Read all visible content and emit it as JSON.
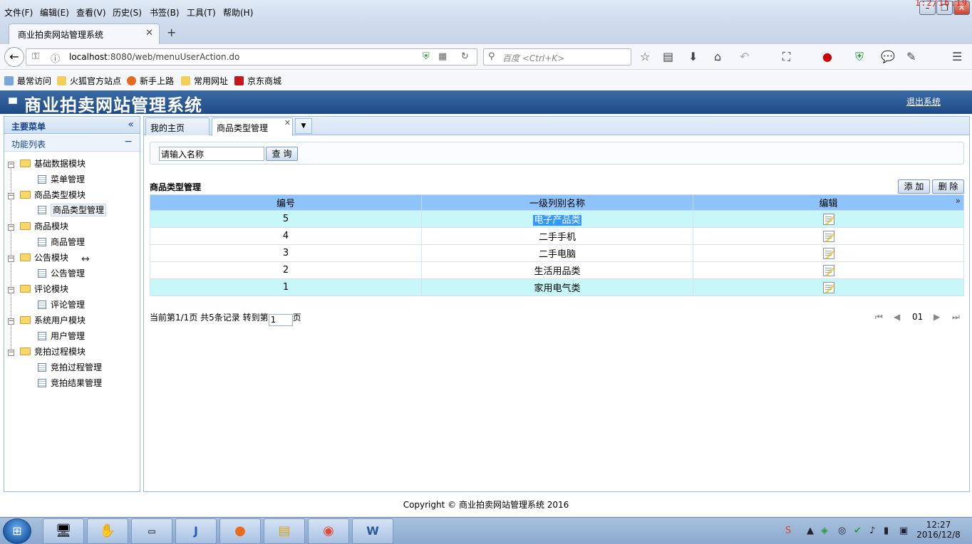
{
  "browser": {
    "menu": [
      "文件(F)",
      "编辑(E)",
      "查看(V)",
      "历史(S)",
      "书签(B)",
      "工具(T)",
      "帮助(H)"
    ],
    "overlay_time": "1:2/16:19",
    "tab_title": "商业拍卖网站管理系统",
    "url_host": "localhost",
    "url_rest": ":8080/web/menuUserAction.do",
    "search_placeholder": "百度 <Ctrl+K>",
    "bookmarks": [
      "最常访问",
      "火狐官方站点",
      "新手上路",
      "常用网址",
      "京东商城"
    ]
  },
  "app": {
    "title": "商业拍卖网站管理系统",
    "logout": "退出系统"
  },
  "sidebar": {
    "header": "主要菜单",
    "section": "功能列表",
    "tree": [
      {
        "label": "基础数据模块",
        "children": [
          "菜单管理"
        ]
      },
      {
        "label": "商品类型模块",
        "children": [
          "商品类型管理"
        ]
      },
      {
        "label": "商品模块",
        "children": [
          "商品管理"
        ]
      },
      {
        "label": "公告模块",
        "children": [
          "公告管理"
        ]
      },
      {
        "label": "评论模块",
        "children": [
          "评论管理"
        ]
      },
      {
        "label": "系统用户模块",
        "children": [
          "用户管理"
        ]
      },
      {
        "label": "竞拍过程模块",
        "children": [
          "竞拍过程管理",
          "竞拍结果管理"
        ]
      }
    ]
  },
  "tabs": [
    "我的主页",
    "商品类型管理"
  ],
  "search": {
    "name_value": "请输入名称",
    "query_label": "查 询"
  },
  "grid": {
    "title": "商品类型管理",
    "add_label": "添 加",
    "delete_label": "删 除",
    "columns": [
      "编号",
      "一级列别名称",
      "编辑"
    ],
    "rows": [
      {
        "id": "5",
        "name": "电子产品类"
      },
      {
        "id": "4",
        "name": "二手手机"
      },
      {
        "id": "3",
        "name": "二手电脑"
      },
      {
        "id": "2",
        "name": "生活用品类"
      },
      {
        "id": "1",
        "name": "家用电气类"
      }
    ]
  },
  "pager": {
    "info": "当前第1/1页 共5条记录 转到第",
    "page_input": "1",
    "suffix": "页",
    "current": "01"
  },
  "footer": "Copyright © 商业拍卖网站管理系统 2016",
  "taskbar": {
    "time": "12:27",
    "date": "2016/12/8"
  }
}
